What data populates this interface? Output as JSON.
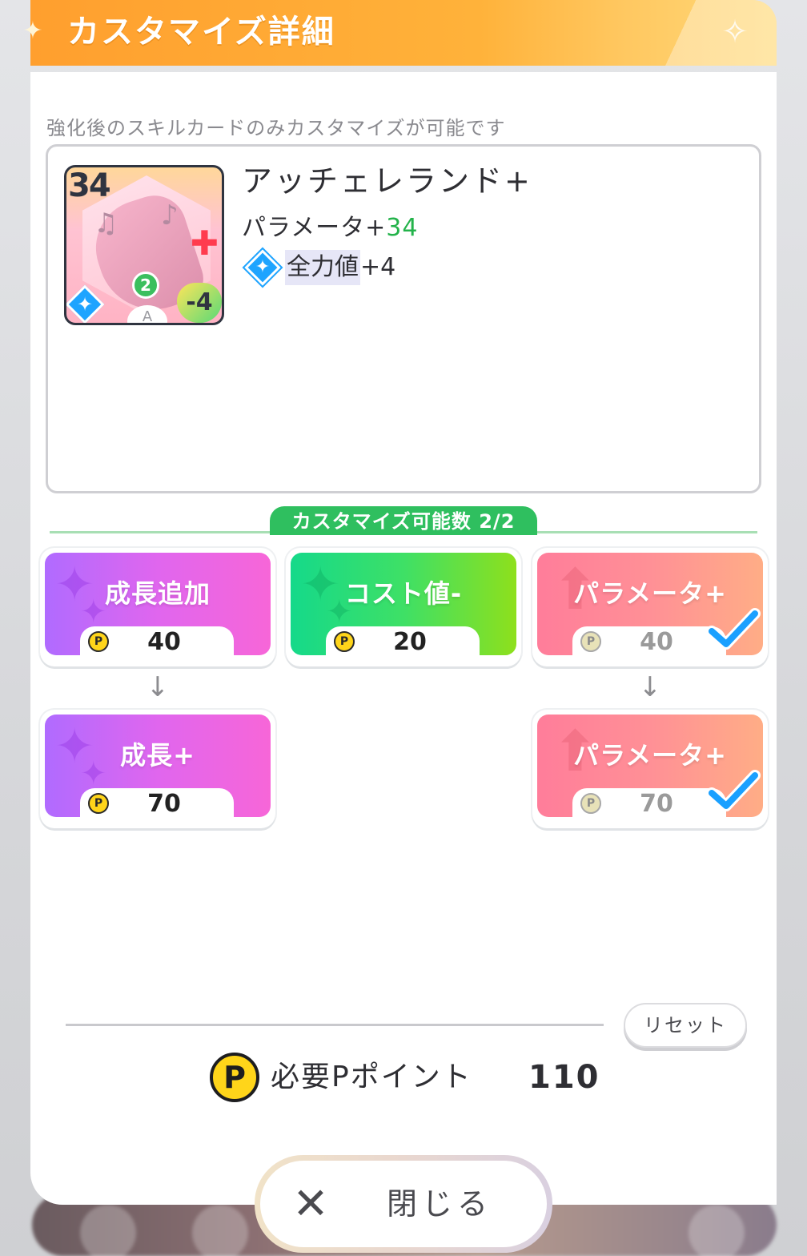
{
  "header": {
    "title": "カスタマイズ詳細"
  },
  "notice": "強化後のスキルカードのみカスタマイズが可能です",
  "card": {
    "thumb_level": "34",
    "thumb_cost": "2",
    "thumb_rank": "A",
    "thumb_heart": "-4",
    "name": "アッチェレランド+",
    "param_label": "パラメータ+",
    "param_value": "34",
    "effect_label": "全力値",
    "effect_value": "+4"
  },
  "custom_count": "カスタマイズ可能数 2/2",
  "options": [
    {
      "label": "成長追加",
      "coin": "P",
      "cost": "40",
      "color": "purple",
      "selected": false
    },
    {
      "label": "コスト値-",
      "coin": "P",
      "cost": "20",
      "color": "green",
      "selected": false
    },
    {
      "label": "パラメータ+",
      "coin": "P",
      "cost": "40",
      "color": "salmon",
      "selected": true
    },
    {
      "label": "成長+",
      "coin": "P",
      "cost": "70",
      "color": "purple",
      "selected": false
    },
    {
      "label": "パラメータ+",
      "coin": "P",
      "cost": "70",
      "color": "salmon",
      "selected": true
    }
  ],
  "reset_label": "リセット",
  "required": {
    "coin": "P",
    "label": "必要Pポイント",
    "value": "110"
  },
  "close_label": "閉じる",
  "colors": {
    "header_orange": "#ffb23a",
    "count_green": "#2fbf5f",
    "check_blue": "#1aa0ff",
    "param_green": "#24b34b"
  }
}
